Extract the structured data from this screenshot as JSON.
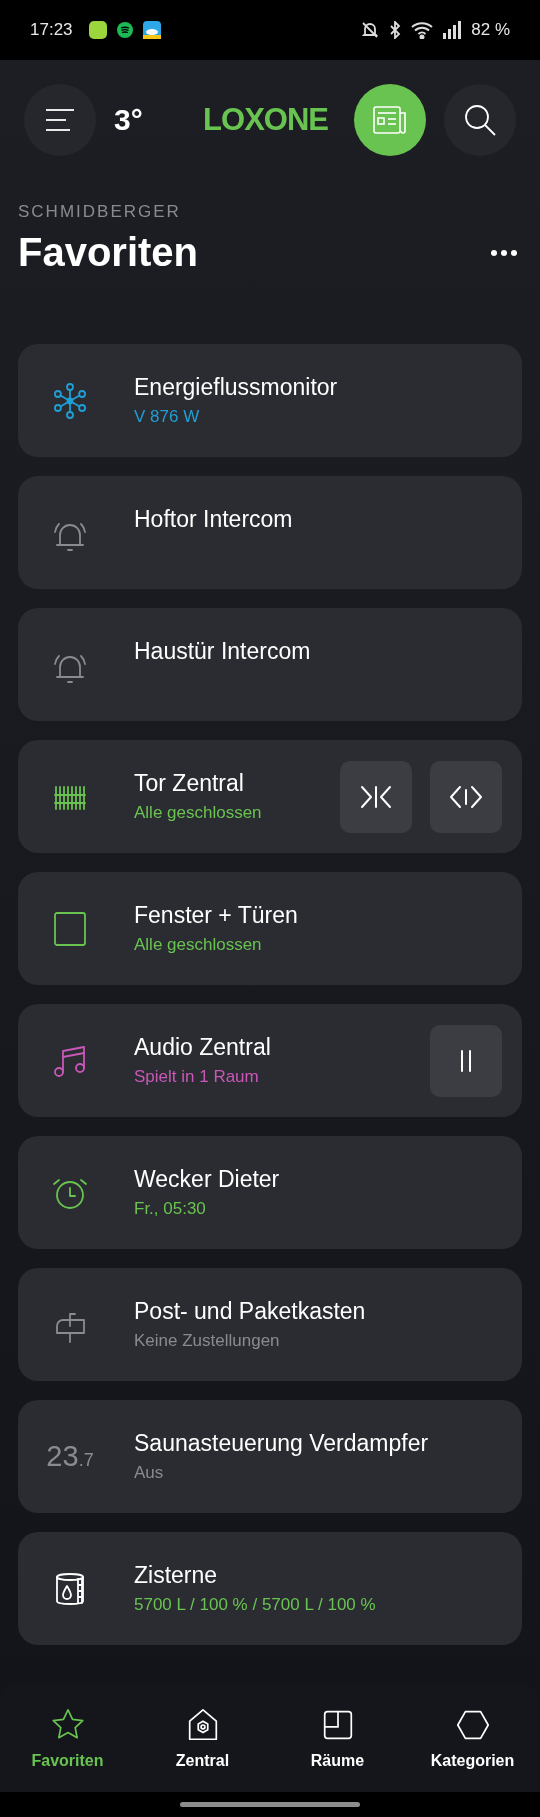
{
  "status_bar": {
    "time": "17:23",
    "battery": "82 %"
  },
  "header": {
    "temperature": "3°",
    "logo": "LOXONE"
  },
  "location": "SCHMIDBERGER",
  "title": "Favoriten",
  "cards": [
    {
      "kind": "energy",
      "title": "Energieflussmonitor",
      "subtitle": "V 876 W",
      "color": "#1f9fd5"
    },
    {
      "kind": "intercom",
      "title": "Hoftor Intercom"
    },
    {
      "kind": "intercom",
      "title": "Haustür Intercom"
    },
    {
      "kind": "gate",
      "title": "Tor Zentral",
      "subtitle": "Alle geschlossen",
      "color": "#69c350",
      "actions": [
        {
          "kind": "close"
        },
        {
          "kind": "open"
        }
      ]
    },
    {
      "kind": "window",
      "title": "Fenster + Türen",
      "subtitle": "Alle geschlossen",
      "color": "#69c350"
    },
    {
      "kind": "audio",
      "title": "Audio Zentral",
      "subtitle": "Spielt in 1 Raum",
      "color": "#c957b8",
      "actions": [
        {
          "kind": "pause"
        }
      ]
    },
    {
      "kind": "alarm",
      "title": "Wecker Dieter",
      "subtitle": "Fr., 05:30",
      "color": "#69c350"
    },
    {
      "kind": "mailbox",
      "title": "Post- und Paketkasten",
      "subtitle": "Keine Zustellungen",
      "color": "#8a8b90"
    },
    {
      "kind": "value",
      "icon_text": "23",
      "icon_text_small": ".7",
      "title": "Saunasteuerung Verdampfer",
      "subtitle": "Aus",
      "color": "#8a8b90"
    },
    {
      "kind": "tank",
      "title": "Zisterne",
      "subtitle": "5700 L / 100 % / 5700 L / 100 %",
      "color": "#69c350"
    }
  ],
  "nav": [
    {
      "kind": "star",
      "label": "Favoriten",
      "selected": true
    },
    {
      "kind": "house",
      "label": "Zentral",
      "selected": false
    },
    {
      "kind": "rooms",
      "label": "Räume",
      "selected": false
    },
    {
      "kind": "hexagon",
      "label": "Kategorien",
      "selected": false
    }
  ]
}
